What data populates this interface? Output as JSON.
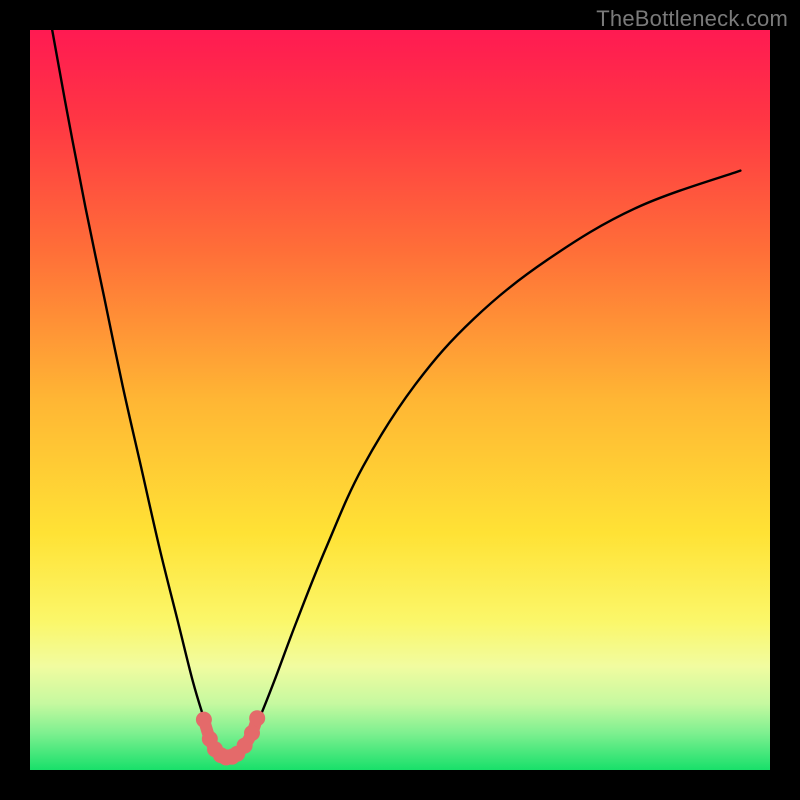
{
  "watermark": "TheBottleneck.com",
  "chart_data": {
    "type": "line",
    "title": "",
    "xlabel": "",
    "ylabel": "",
    "xlim": [
      0,
      100
    ],
    "ylim": [
      0,
      100
    ],
    "grid": false,
    "legend": "none",
    "background_gradient": {
      "stops": [
        {
          "pos": 0.0,
          "color": "#ff1a52"
        },
        {
          "pos": 0.12,
          "color": "#ff3644"
        },
        {
          "pos": 0.3,
          "color": "#ff6f38"
        },
        {
          "pos": 0.5,
          "color": "#ffb634"
        },
        {
          "pos": 0.68,
          "color": "#ffe235"
        },
        {
          "pos": 0.8,
          "color": "#fbf76a"
        },
        {
          "pos": 0.86,
          "color": "#f1fca0"
        },
        {
          "pos": 0.91,
          "color": "#c6f9a0"
        },
        {
          "pos": 0.95,
          "color": "#7ef090"
        },
        {
          "pos": 1.0,
          "color": "#18e06a"
        }
      ]
    },
    "series": [
      {
        "name": "left-curve",
        "color": "#000000",
        "x": [
          3.0,
          5.0,
          7.5,
          10.0,
          12.5,
          15.0,
          17.5,
          20.0,
          22.0,
          23.5,
          24.5,
          25.5
        ],
        "values": [
          100,
          89,
          76,
          64,
          52,
          41,
          30,
          20,
          12,
          7,
          4,
          2
        ]
      },
      {
        "name": "right-curve",
        "color": "#000000",
        "x": [
          28.5,
          29.5,
          31.0,
          33.0,
          36.0,
          40.0,
          45.0,
          52.0,
          60.0,
          70.0,
          82.0,
          96.0
        ],
        "values": [
          2,
          4,
          7,
          12,
          20,
          30,
          41,
          52,
          61,
          69,
          76,
          81
        ]
      },
      {
        "name": "valley-markers",
        "color": "#e46a6a",
        "x": [
          23.5,
          24.3,
          25.0,
          25.8,
          26.5,
          27.3,
          28.0,
          29.0,
          30.0,
          30.7
        ],
        "values": [
          6.8,
          4.2,
          2.8,
          2.0,
          1.7,
          1.8,
          2.2,
          3.3,
          5.0,
          7.0
        ]
      }
    ]
  }
}
